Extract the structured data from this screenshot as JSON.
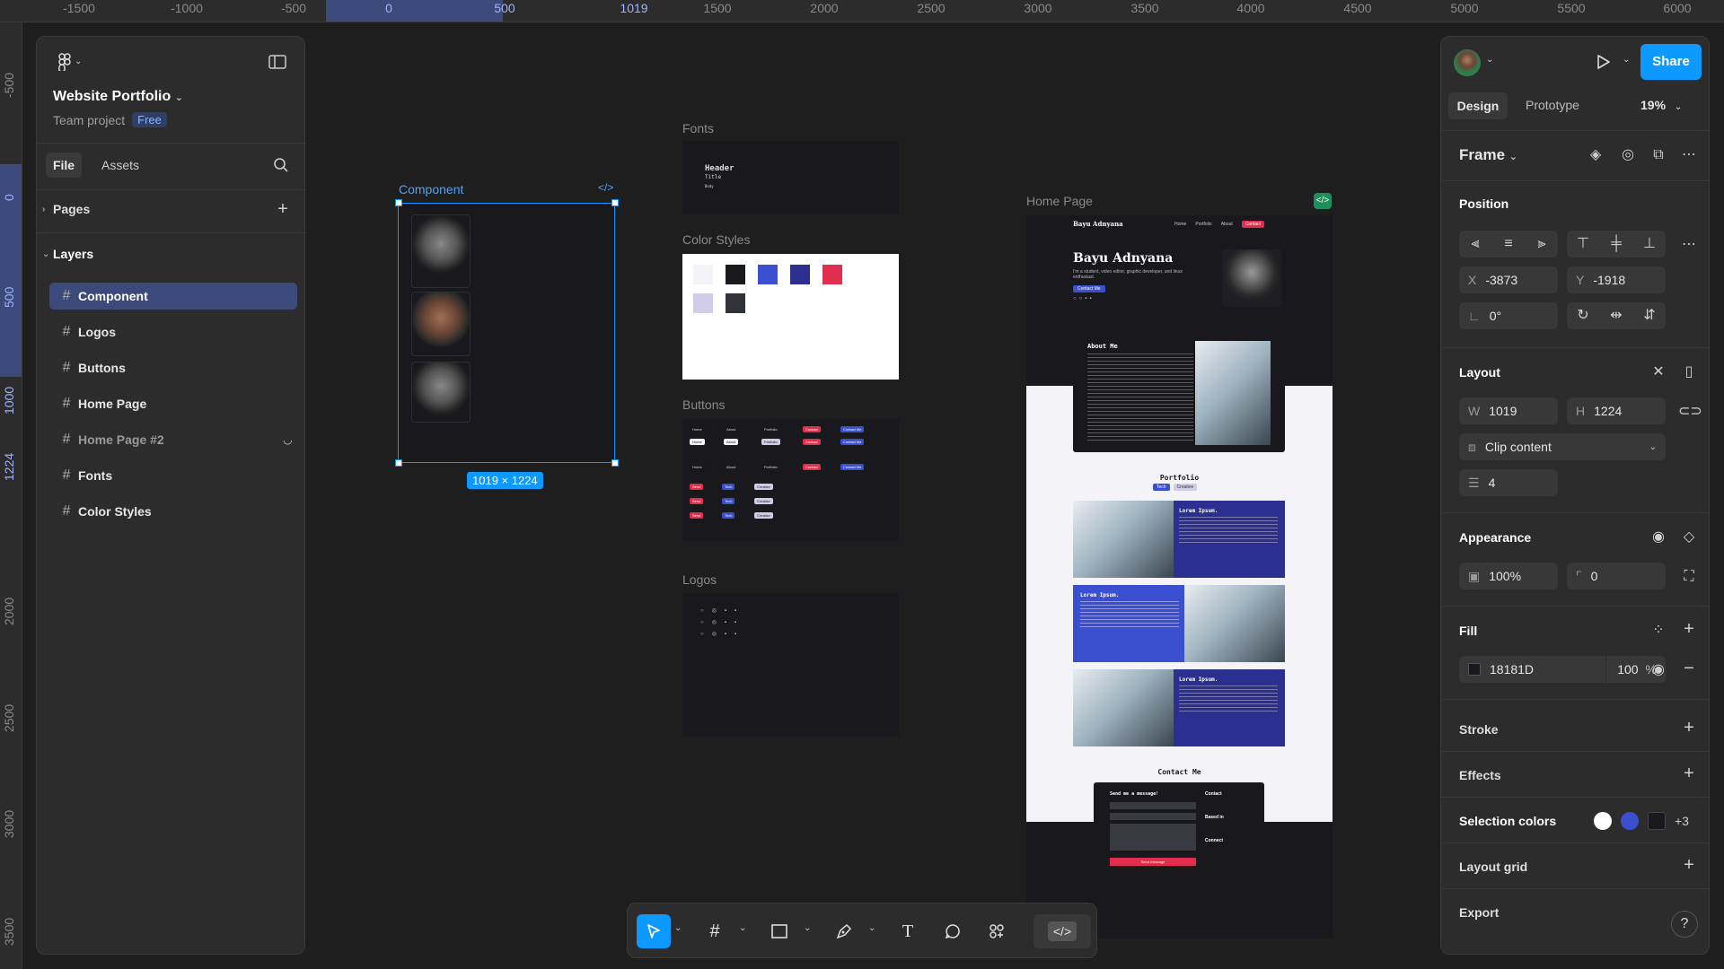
{
  "ruler": {
    "top": [
      "-1500",
      "-1000",
      "-500",
      "0",
      "500",
      "1019",
      "1500",
      "2000",
      "2500",
      "3000",
      "3500",
      "4000",
      "4500",
      "5000",
      "5500",
      "6000"
    ],
    "left": [
      "-500",
      "0",
      "500",
      "1000",
      "1224",
      "2000",
      "2500",
      "3000",
      "3500"
    ]
  },
  "left_panel": {
    "project_title": "Website Portfolio",
    "team": "Team project",
    "plan_badge": "Free",
    "tabs": [
      "File",
      "Assets"
    ],
    "pages_label": "Pages",
    "layers_label": "Layers",
    "layers": [
      {
        "label": "Component",
        "selected": true
      },
      {
        "label": "Logos"
      },
      {
        "label": "Buttons"
      },
      {
        "label": "Home Page"
      },
      {
        "label": "Home Page #2",
        "hidden": true
      },
      {
        "label": "Fonts"
      },
      {
        "label": "Color Styles"
      }
    ]
  },
  "canvas": {
    "component_label": "Component",
    "dimension_badge": "1019 × 1224",
    "fonts_label": "Fonts",
    "fonts_preview": [
      "Header",
      "Title",
      "Body"
    ],
    "color_styles_label": "Color Styles",
    "swatches": [
      "#f3f3f8",
      "#18181d",
      "#3b4fd1",
      "#2b2f8f",
      "#e02e4c",
      "#cfcde8",
      "#32323a"
    ],
    "buttons_label": "Buttons",
    "buttons_rows": [
      [
        "Home",
        "About",
        "Portfolio",
        "Contact",
        "Contact Me"
      ],
      [
        "Home",
        "About",
        "Portfolio",
        "Contact",
        "Contact Me"
      ],
      [
        "Home",
        "About",
        "Portfolio",
        "Contact",
        "Contact Me"
      ]
    ],
    "buttons_tags": [
      [
        "Send",
        "Tech",
        "Creative"
      ],
      [
        "Send",
        "Tech",
        "Creative"
      ],
      [
        "Send",
        "Tech",
        "Creative"
      ]
    ],
    "logos_label": "Logos",
    "home_label": "Home Page",
    "home": {
      "brand": "Bayu Adnyana",
      "nav": [
        "Home",
        "Portfolio",
        "About",
        "Contact"
      ],
      "hero_name": "Bayu Adnyana",
      "hero_text": "I'm a student, video editor, graphic developer, and linux enthusiast.",
      "hero_button": "Contact Me",
      "about_title": "About Me",
      "portfolio_title": "Portfolio",
      "portfolio_tags": [
        "Tech",
        "Creative"
      ],
      "card_title": "Lorem Ipsum.",
      "contact_title": "Contact Me",
      "form_title": "Send me a message!",
      "send_button": "Send message",
      "contact_heading": "Contact",
      "based_heading": "Based in",
      "connect_heading": "Connect"
    }
  },
  "right_panel": {
    "tabs": [
      "Design",
      "Prototype"
    ],
    "zoom": "19%",
    "share": "Share",
    "frame_label": "Frame",
    "position_label": "Position",
    "x_label": "X",
    "x": "-3873",
    "y_label": "Y",
    "y": "-1918",
    "rotation": "0°",
    "layout_label": "Layout",
    "w_label": "W",
    "w": "1019",
    "h_label": "H",
    "h": "1224",
    "clip": "Clip content",
    "gap": "4",
    "appearance_label": "Appearance",
    "opacity": "100%",
    "radius": "0",
    "fill_label": "Fill",
    "fill_hex": "18181D",
    "fill_opacity": "100",
    "fill_pct": "%",
    "fill_color": "#18181d",
    "stroke_label": "Stroke",
    "effects_label": "Effects",
    "selection_colors_label": "Selection colors",
    "selection_colors": [
      "#ffffff",
      "#3b4fd1",
      "#18181d"
    ],
    "selection_more": "+3",
    "layout_grid_label": "Layout grid",
    "export_label": "Export"
  },
  "colors": {
    "accent": "#0d99ff",
    "selected_layer": "#3b4a7a",
    "canvas": "#1e1e1e"
  }
}
